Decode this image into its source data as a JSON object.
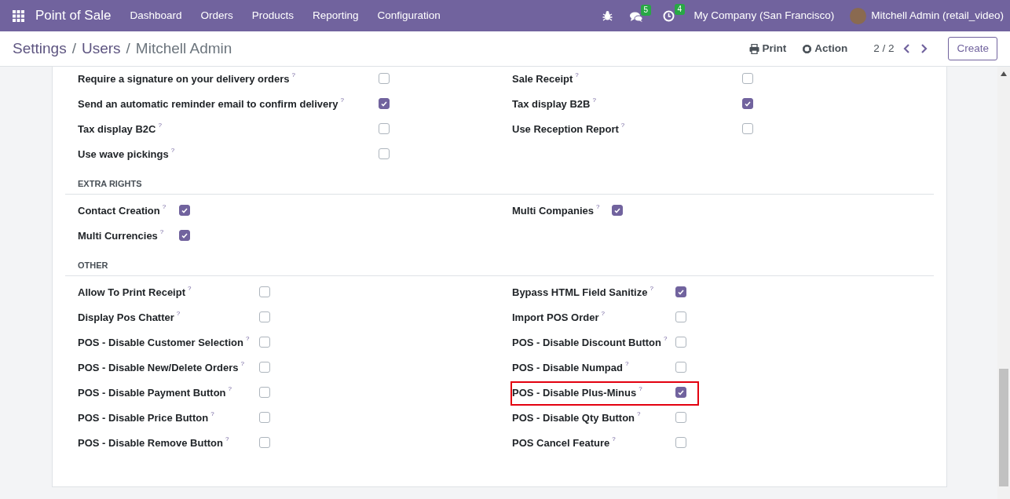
{
  "navbar": {
    "app_title": "Point of Sale",
    "menu": [
      "Dashboard",
      "Orders",
      "Products",
      "Reporting",
      "Configuration"
    ],
    "messages_badge": "5",
    "activities_badge": "4",
    "company": "My Company (San Francisco)",
    "user": "Mitchell Admin (retail_video)"
  },
  "control_panel": {
    "breadcrumbs": [
      {
        "label": "Settings",
        "separator": "/"
      },
      {
        "label": "Users",
        "separator": "/"
      },
      {
        "label": "Mitchell Admin"
      }
    ],
    "print": "Print",
    "action": "Action",
    "pager": "2 / 2",
    "create": "Create"
  },
  "sections": [
    {
      "left": [
        {
          "label": "Require a signature on your delivery orders",
          "help": "?",
          "checked": false,
          "highlighted": false
        },
        {
          "label": "Send an automatic reminder email to confirm delivery",
          "help": "?",
          "checked": true,
          "highlighted": false
        },
        {
          "label": "Tax display B2C",
          "help": "?",
          "checked": false,
          "highlighted": false
        },
        {
          "label": "Use wave pickings",
          "help": "?",
          "checked": false,
          "highlighted": false
        }
      ],
      "right": [
        {
          "label": "Sale Receipt",
          "help": "?",
          "checked": false,
          "highlighted": false
        },
        {
          "label": "Tax display B2B",
          "help": "?",
          "checked": true,
          "highlighted": false
        },
        {
          "label": "Use Reception Report",
          "help": "?",
          "checked": false,
          "highlighted": false
        }
      ]
    },
    {
      "title": "EXTRA RIGHTS",
      "left": [
        {
          "label": "Contact Creation",
          "help": "?",
          "checked": true,
          "highlighted": false
        },
        {
          "label": "Multi Currencies",
          "help": "?",
          "checked": true,
          "highlighted": false
        }
      ],
      "right": [
        {
          "label": "Multi Companies",
          "help": "?",
          "checked": true,
          "highlighted": false
        }
      ]
    },
    {
      "title": "OTHER",
      "left": [
        {
          "label": "Allow To Print Receipt",
          "help": "?",
          "checked": false,
          "highlighted": false
        },
        {
          "label": "Display Pos Chatter",
          "help": "?",
          "checked": false,
          "highlighted": false
        },
        {
          "label": "POS - Disable Customer Selection",
          "help": "?",
          "checked": false,
          "highlighted": false
        },
        {
          "label": "POS - Disable New/Delete Orders ",
          "help": "?",
          "checked": false,
          "highlighted": false
        },
        {
          "label": "POS - Disable Payment Button",
          "help": "?",
          "checked": false,
          "highlighted": false
        },
        {
          "label": "POS - Disable Price Button",
          "help": "?",
          "checked": false,
          "highlighted": false
        },
        {
          "label": "POS - Disable Remove Button",
          "help": "?",
          "checked": false,
          "highlighted": false
        }
      ],
      "right": [
        {
          "label": "Bypass HTML Field Sanitize",
          "help": "?",
          "checked": true,
          "highlighted": false
        },
        {
          "label": "Import POS Order",
          "help": "?",
          "checked": false,
          "highlighted": false
        },
        {
          "label": "POS - Disable Discount Button",
          "help": "?",
          "checked": false,
          "highlighted": false
        },
        {
          "label": "POS - Disable Numpad",
          "help": "?",
          "checked": false,
          "highlighted": false
        },
        {
          "label": "POS - Disable Plus-Minus",
          "help": "?",
          "checked": true,
          "highlighted": true
        },
        {
          "label": "POS - Disable Qty Button",
          "help": "?",
          "checked": false,
          "highlighted": false
        },
        {
          "label": "POS Cancel Feature",
          "help": "?",
          "checked": false,
          "highlighted": false
        }
      ]
    }
  ]
}
